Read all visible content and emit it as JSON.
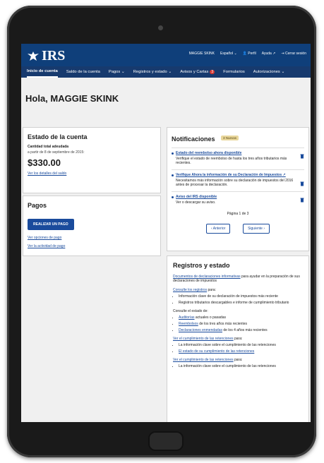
{
  "header": {
    "logo_text": "IRS",
    "utility": {
      "user": "MAGGIE SKINK",
      "language": "Español",
      "profile": "Perfil",
      "help": "Ayuda",
      "logout": "Cerrar sesión"
    }
  },
  "nav": {
    "tabs": [
      {
        "label": "Inicio de cuenta"
      },
      {
        "label": "Saldo de la cuenta"
      },
      {
        "label": "Pagos"
      },
      {
        "label": "Registros y estado"
      },
      {
        "label": "Avisos y Cartas"
      },
      {
        "label": "Formularios"
      },
      {
        "label": "Autorizaciones"
      }
    ],
    "notices_badge": "3"
  },
  "greeting": "Hola, MAGGIE SKINK",
  "account": {
    "title": "Estado de la cuenta",
    "label": "Cantidad total adeudada",
    "as_of": "a partir de 8 de septiembre de 2015:",
    "amount": "$330.00",
    "details_link": "Ver los detalles del saldo"
  },
  "payments": {
    "title": "Pagos",
    "make_payment": "REALIZAR UN PAGO",
    "options_link": "Ver opciones de pago",
    "activity_link": "Ver la actividad de pago"
  },
  "notifications": {
    "title": "Notificaciones",
    "tag": "3 Nuevas",
    "items": [
      {
        "title": "Estado del reembolso ahora disponible",
        "body": "Verifique el estado de reembolso de hasta los tres años tributarios más recientes."
      },
      {
        "title": "Verifique Ahora la información de su Declaración de Impuestos",
        "body": "Necesitamos más información sobre su declaración de impuestos del 2016 antes de procesar la declaración."
      },
      {
        "title": "Aviso del IRS disponible",
        "body": "Ver o descargar su aviso."
      }
    ],
    "page_info": "Página 1 de 3",
    "prev": "Anterior",
    "next": "Siguiente"
  },
  "records": {
    "title": "Registros y estado",
    "intro_link": "Documentos de declaraciones informativas",
    "intro_rest": "para ayudar en la preparación de sus declaraciones de impuestos",
    "consult_link": "Consulte los registros",
    "consult_rest": "para:",
    "list1": [
      "Información clave de su declaración de impuestos más reciente",
      "Registros tributarios descargables e informe de cumplimiento tributario"
    ],
    "status_label": "Consulte el estado de:",
    "status": [
      {
        "link": "Auditorías",
        "rest": "actuales o pasadas"
      },
      {
        "link": "Reembolsos",
        "rest": "de los tres años más recientes"
      },
      {
        "link": "Declaraciones enmendadas",
        "rest": "de los 4 años más recientes"
      }
    ],
    "withholding_link": "Ver el cumplimiento de las retenciones",
    "withholding_rest": "para:",
    "list2": [
      "La información clave sobre el cumplimiento de las retenciones",
      "El estado de su cumplimiento de las retenciones"
    ],
    "withholding_link2": "Ver el cumplimiento de las retenciones",
    "withholding_rest2": "para:",
    "list3": [
      "La información clave sobre el cumplimiento de las retenciones"
    ]
  }
}
